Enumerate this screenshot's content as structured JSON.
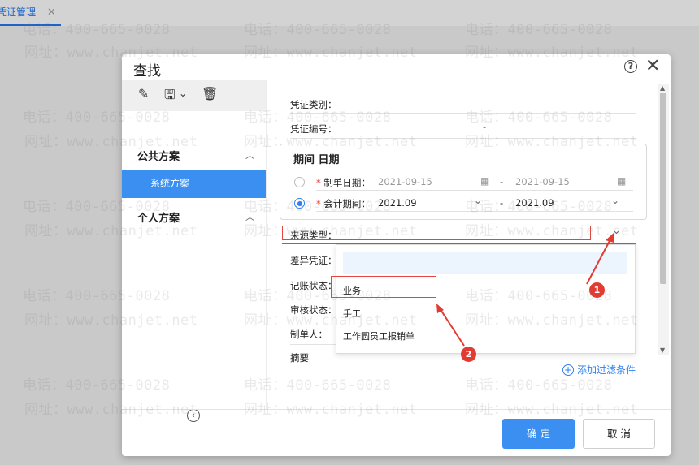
{
  "tab": {
    "title": "凭证管理",
    "close": "✕"
  },
  "watermark": {
    "phone": "电话：400-665-0028",
    "site": "网址：www.chanjet.net"
  },
  "dialog": {
    "title": "查找",
    "help": "?",
    "close": "✕",
    "toolbar": {
      "edit": "✎",
      "save": "🖫",
      "save_more": "⌄",
      "delete": "🗑"
    },
    "left": {
      "public_label": "公共方案",
      "system_label": "系统方案",
      "private_label": "个人方案",
      "collapse_glyph": "‹",
      "chevron": "︿"
    },
    "fields": {
      "voucher_type": "凭证类别：",
      "voucher_no": "凭证编号：",
      "voucher_no_dash": "-",
      "period_title": "期间 日期",
      "date_label": "制单日期：",
      "date_from": "2021-09-15",
      "date_to": "2021-09-15",
      "period_label": "会计期间：",
      "period_from": "2021.09",
      "period_to": "2021.09",
      "range_dash": "-",
      "required_mark": "*",
      "source_type": "来源类型：",
      "diff_voucher": "差异凭证：",
      "post_status": "记账状态：",
      "audit_status": "审核状态：",
      "maker": "制单人：",
      "summary": "摘要"
    },
    "dropdown": {
      "options": [
        "业务",
        "手工",
        "工作圆员工报销单"
      ]
    },
    "add_filter": "添加过滤条件",
    "ok": "确 定",
    "cancel": "取 消"
  },
  "annotations": {
    "badge1": "1",
    "badge2": "2"
  },
  "colors": {
    "accent": "#3a8ff0",
    "annotation": "#e23b32"
  }
}
